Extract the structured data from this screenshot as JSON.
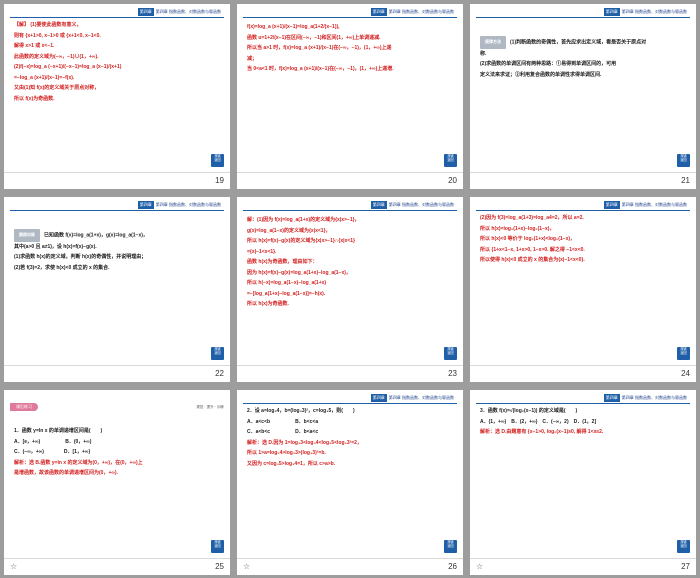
{
  "header_text": "第四章 指数函数、对数函数与幂函数",
  "header_label": "第四章",
  "nav_button": [
    "按键",
    "返回"
  ],
  "slides": [
    {
      "number": "19",
      "lines": [
        {
          "text": "【解】 (1)要使此函数有意义，",
          "c": "red"
        },
        {
          "text": "则有 {x+1>0, x−1>0 或 {x+1<0, x−1<0.",
          "c": "red"
        },
        {
          "text": "解得 x>1 或 x<−1.",
          "c": "red"
        },
        {
          "text": "此函数的定义域为(−∞，−1)∪(1，+∞).",
          "c": "red"
        },
        {
          "text": "(2)f(−x)=log_a (−x+1)/(−x−1)=log_a (x−1)/(x+1)",
          "c": "red"
        },
        {
          "text": "=−log_a (x+1)/(x−1)=−f(x).",
          "c": "red"
        },
        {
          "text": "又由(1)知 f(x)的定义域关于原点对称，",
          "c": "red"
        },
        {
          "text": "所以 f(x)为奇函数.",
          "c": "red"
        }
      ]
    },
    {
      "number": "20",
      "lines": [
        {
          "text": "f(x)=log_a (x+1)/(x−1)=log_a(1+2/(x−1)),",
          "c": "red"
        },
        {
          "text": "函数 u=1+2/(x−1)在区间(−∞，−1)和区间(1，+∞)上单调递减.",
          "c": "red"
        },
        {
          "text": "所以当 a>1 时，f(x)=log_a (x+1)/(x−1)在(−∞，−1)，(1，+∞)上递",
          "c": "red"
        },
        {
          "text": "减；",
          "c": "red"
        },
        {
          "text": "当 0<a<1 时，f(x)=log_a (x+1)/(x−1)在(−∞，−1)，(1，+∞)上递增.",
          "c": "red"
        }
      ]
    },
    {
      "number": "21",
      "badge": "规律方法",
      "lines": [
        {
          "text": "(1)判断函数的奇偶性，首先应求出定义域，看是否关于原点对",
          "c": "blk"
        },
        {
          "text": "称.",
          "c": "blk"
        },
        {
          "text": "(2)求函数的单调区间有两种思路：①易得到单调区间的，可用",
          "c": "blk"
        },
        {
          "text": "定义法来求证；②利用复合函数的单调性求得单调区间.",
          "c": "blk"
        }
      ]
    },
    {
      "number": "22",
      "badge": "跟踪训练",
      "lines": [
        {
          "text": "已知函数 f(x)=log_a(1+x)，g(x)=log_a(1−x)，",
          "c": "blk"
        },
        {
          "text": "其中(a>0 且 a≠1)，设 h(x)=f(x)−g(x).",
          "c": "blk"
        },
        {
          "text": "(1)求函数 h(x)的定义域，判断 h(x)的奇偶性，并说明理由；",
          "c": "blk"
        },
        {
          "text": "(2)若 f(3)=2，求使 h(x)<0 成立的 x 的集合.",
          "c": "blk"
        }
      ]
    },
    {
      "number": "23",
      "lines": [
        {
          "text": "解：(1)因为 f(x)=log_a(1+x)的定义域为{x|x>−1}，",
          "c": "red"
        },
        {
          "text": "g(x)=log_a(1−x)的定义域为{x|x<1}，",
          "c": "red"
        },
        {
          "text": "所以 h(x)=f(x)−g(x)的定义域为{x|x>−1}∩{x|x<1}",
          "c": "red"
        },
        {
          "text": "={x|−1<x<1}.",
          "c": "red"
        },
        {
          "text": "函数 h(x)为奇函数，理由如下：",
          "c": "red"
        },
        {
          "text": "因为 h(x)=f(x)−g(x)=log_a(1+x)−log_a(1−x)，",
          "c": "red"
        },
        {
          "text": "所以 h(−x)=log_a(1−x)−log_a(1+x)",
          "c": "red"
        },
        {
          "text": "=−[log_a(1+x)−log_a(1−x)]=−h(x).",
          "c": "red"
        },
        {
          "text": "所以 h(x)为奇函数.",
          "c": "red"
        }
      ]
    },
    {
      "number": "24",
      "lines": [
        {
          "text": "(2)因为 f(3)=log_a(1+3)=log_a4=2，所以 a=2.",
          "c": "red"
        },
        {
          "text": "所以 h(x)=log₂(1+x)−log₂(1−x)，",
          "c": "red"
        },
        {
          "text": "所以 h(x)<0 等价于 log₂(1+x)<log₂(1−x)，",
          "c": "red"
        },
        {
          "text": "所以 {1+x<1−x, 1+x>0, 1−x>0.  解之得 −1<x<0.",
          "c": "red"
        },
        {
          "text": "所以使得 h(x)<0 成立的 x 的集合为{x|−1<x<0}.",
          "c": "red"
        }
      ]
    },
    {
      "number": "25",
      "banner": "课后练习",
      "banner_right": "规范 · 提升 · 训练",
      "lines": [
        {
          "text": "1．函数 y=ln x 的单调递增区间是(　　)",
          "c": "blk"
        },
        {
          "text": "A．[e，+∞)　　　　　B．(0，+∞)",
          "c": "blk"
        },
        {
          "text": "C．(−∞，+∞)　　　　D．[1，+∞)",
          "c": "blk"
        },
        {
          "text": "解析：选 B.函数 y=ln x 的定义域为(0，+∞)，在(0，+∞)上",
          "c": "red"
        },
        {
          "text": "是增函数，故该函数的单调递增区间为(0，+∞).",
          "c": "red"
        }
      ]
    },
    {
      "number": "26",
      "lines": [
        {
          "text": "2．设 a=log₃4，b=(log₃3)²，c=log₃5，则(　　)",
          "c": "blk"
        },
        {
          "text": "A．a<c<b　　　　　B．b<c<a",
          "c": "blk"
        },
        {
          "text": "C．a<b<c　　　　　D．b<a<c",
          "c": "blk"
        },
        {
          "text": "解析：选 D.因为 1=log₃3<log₃4<log₃5<log₃3²=2，",
          "c": "red"
        },
        {
          "text": "所以 1>a=log₃4>log₃3>(log₃3)²=b.",
          "c": "red"
        },
        {
          "text": "又因为 c=log₃5>log₃4=1，所以 c>a>b.",
          "c": "red"
        }
      ]
    },
    {
      "number": "27",
      "lines": [
        {
          "text": "3．函数 f(x)=√(log₂(x−1)) 的定义域是(　　)",
          "c": "blk"
        },
        {
          "text": "A．(1，+∞)　B．(2，+∞)　C．(−∞，2)　D．(1，2]",
          "c": "blk"
        },
        {
          "text": "解析：选 D.由题意有 {x−1>0, log₂(x−1)≥0, 解得 1<x≤2.",
          "c": "red"
        }
      ]
    }
  ]
}
